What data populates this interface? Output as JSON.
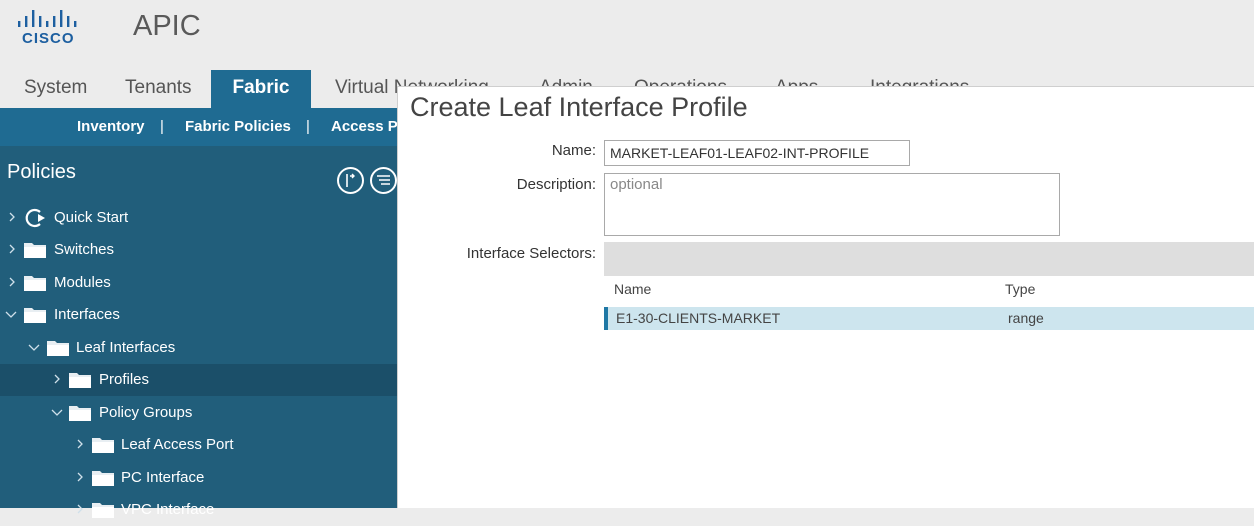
{
  "header": {
    "logo_text": "CISCO",
    "app_title": "APIC"
  },
  "tabs": [
    {
      "label": "System"
    },
    {
      "label": "Tenants"
    },
    {
      "label": "Fabric",
      "active": true
    },
    {
      "label": "Virtual Networking"
    },
    {
      "label": "Admin"
    },
    {
      "label": "Operations"
    },
    {
      "label": "Apps"
    },
    {
      "label": "Integrations"
    }
  ],
  "subnav": {
    "items": [
      "Inventory",
      "Fabric Policies",
      "Access Policies"
    ],
    "separator": "|"
  },
  "sidebar": {
    "title": "Policies",
    "tree": [
      {
        "label": "Quick Start",
        "icon": "quick-start-icon",
        "expanded": false
      },
      {
        "label": "Switches",
        "icon": "folder-icon",
        "expanded": false
      },
      {
        "label": "Modules",
        "icon": "folder-icon",
        "expanded": false
      },
      {
        "label": "Interfaces",
        "icon": "folder-icon",
        "expanded": true
      },
      {
        "label": "Leaf Interfaces",
        "icon": "folder-icon",
        "expanded": true
      },
      {
        "label": "Profiles",
        "icon": "folder-icon",
        "expanded": false,
        "selected": true
      },
      {
        "label": "Policy Groups",
        "icon": "folder-icon",
        "expanded": true
      },
      {
        "label": "Leaf Access Port",
        "icon": "folder-icon",
        "expanded": false
      },
      {
        "label": "PC Interface",
        "icon": "folder-icon",
        "expanded": false
      },
      {
        "label": "VPC Interface",
        "icon": "folder-icon",
        "expanded": false
      }
    ]
  },
  "dialog": {
    "title": "Create Leaf Interface Profile",
    "name_label": "Name:",
    "name_value": "MARKET-LEAF01-LEAF02-INT-PROFILE",
    "description_label": "Description:",
    "description_placeholder": "optional",
    "selectors_label": "Interface Selectors:",
    "selectors_columns": [
      "Name",
      "Type"
    ],
    "selectors_rows": [
      {
        "name": "E1-30-CLIENTS-MARKET",
        "type": "range"
      }
    ]
  },
  "colors": {
    "brand_blue": "#1f6b92",
    "sidebar_bg": "#215e7b",
    "selected_row": "#cde5ee"
  }
}
